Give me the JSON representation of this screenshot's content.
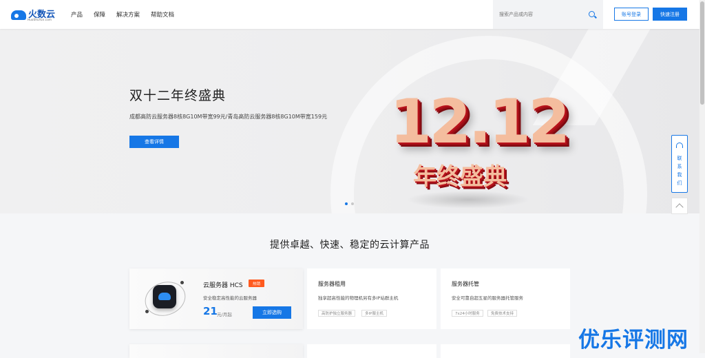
{
  "header": {
    "logo_text": "火数云",
    "logo_sub": "HuoShuYun.com",
    "nav": [
      "产品",
      "保障",
      "解决方案",
      "帮助文档"
    ],
    "search_placeholder": "搜索产品或内容",
    "login_label": "账号登录",
    "register_label": "快速注册"
  },
  "banner": {
    "title": "双十二年终盛典",
    "desc": "成都高防云服务器8核8G10M带宽99元/青岛高防云服务器8核8G10M带宽159元",
    "button": "查看详情",
    "art_number": "12.12",
    "art_sub": "年终盛典",
    "slide_index": 1,
    "slide_count": 2
  },
  "float": {
    "contact_label": "联系我们"
  },
  "products": {
    "section_title": "提供卓越、快速、稳定的云计算产品",
    "hcs": {
      "title": "云服务器 HCS",
      "badge": "热销",
      "desc": "安全稳定高性能的云服务器",
      "price": "21",
      "unit": "元/月起",
      "button": "立即选购"
    },
    "physical": {
      "title": "服务器租用",
      "desc": "独享超高性能的物理机另有多IP站群主机",
      "tags": [
        "高防护独立服务器",
        "多IP服主机"
      ]
    },
    "hosting": {
      "title": "服务器托管",
      "desc": "安全可靠自超五星的服务器托管服务",
      "tags": [
        "7x24小时服务",
        "免费技术支持"
      ]
    }
  },
  "watermark": "优乐评测网",
  "colors": {
    "accent": "#1677e6",
    "hot": "#ff5a1f"
  }
}
